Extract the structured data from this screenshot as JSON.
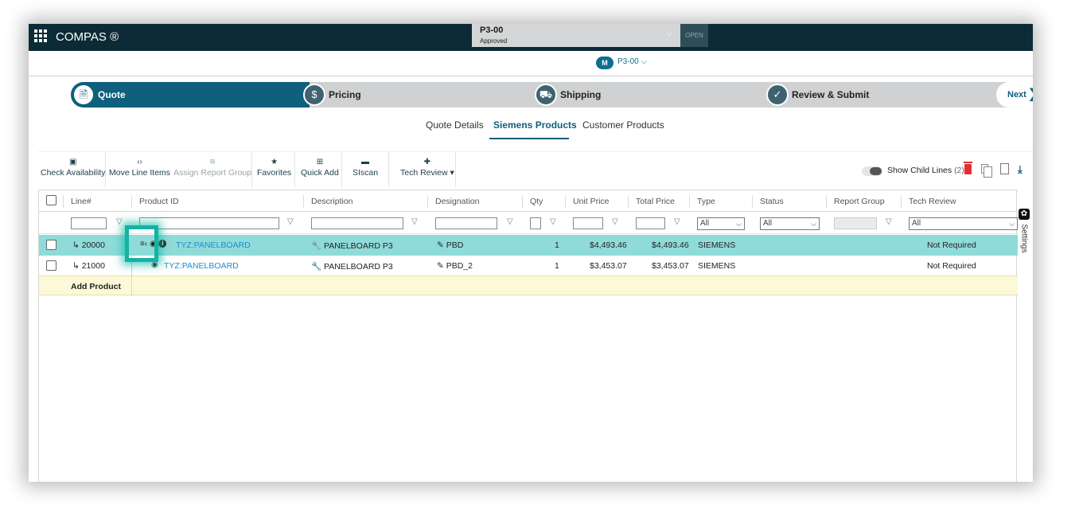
{
  "app": {
    "title": "COMPAS ®",
    "document": {
      "name": "P3-00",
      "status": "Approved",
      "badge": "OPEN"
    },
    "user_initial": "M",
    "user_document": "P3-00 ⌵"
  },
  "stepper": {
    "steps": [
      {
        "label": "Quote",
        "icon": "document-icon",
        "glyph": "🗎",
        "active": true
      },
      {
        "label": "Pricing",
        "icon": "dollar-icon",
        "glyph": "$",
        "active": false
      },
      {
        "label": "Shipping",
        "icon": "truck-icon",
        "glyph": "⛟",
        "active": false
      },
      {
        "label": "Review & Submit",
        "icon": "check-icon",
        "glyph": "✓",
        "active": false
      }
    ],
    "next_label": "Next",
    "next_glyph": "❯"
  },
  "subtabs": [
    "Quote Details",
    "Siemens Products",
    "Customer Products"
  ],
  "subtab_active": "Siemens Products",
  "toolbar": {
    "check_availability": "Check Availability",
    "move_line_items": "Move Line Items",
    "assign_report_group": "Assign Report Group",
    "favorites": "Favorites",
    "quick_add": "Quick Add",
    "siscan": "SIscan",
    "tech_review": "Tech Review ▾",
    "show_child_lines": "Show Child Lines",
    "child_count": "(2)"
  },
  "grid": {
    "columns": [
      "Line#",
      "Product ID",
      "Description",
      "Designation",
      "Qty",
      "Unit Price",
      "Total Price",
      "Type",
      "Status",
      "Report Group",
      "Tech Review"
    ],
    "filter_all": "All",
    "rows": [
      {
        "line": "↳ 20000",
        "product_id": "TYZ:PANELBOARD",
        "description": "PANELBOARD P3",
        "designation": "PBD",
        "qty": "1",
        "unit_price": "$4,493.46",
        "total_price": "$4,493.46",
        "type": "SIEMENS",
        "status": "",
        "report_group": "",
        "tech_review": "Not Required"
      },
      {
        "line": "↳ 21000",
        "product_id": "TYZ:PANELBOARD",
        "description": "PANELBOARD P3",
        "designation": "PBD_2",
        "qty": "1",
        "unit_price": "$3,453.07",
        "total_price": "$3,453.07",
        "type": "SIEMENS",
        "status": "",
        "report_group": "",
        "tech_review": "Not Required"
      }
    ],
    "add_product": "Add Product"
  },
  "settings_label": "Settings",
  "colors": {
    "header_bg": "#0d2b36",
    "accent": "#0e607c",
    "selected_row": "#8fdbd9",
    "highlight": "#14b3a4"
  }
}
